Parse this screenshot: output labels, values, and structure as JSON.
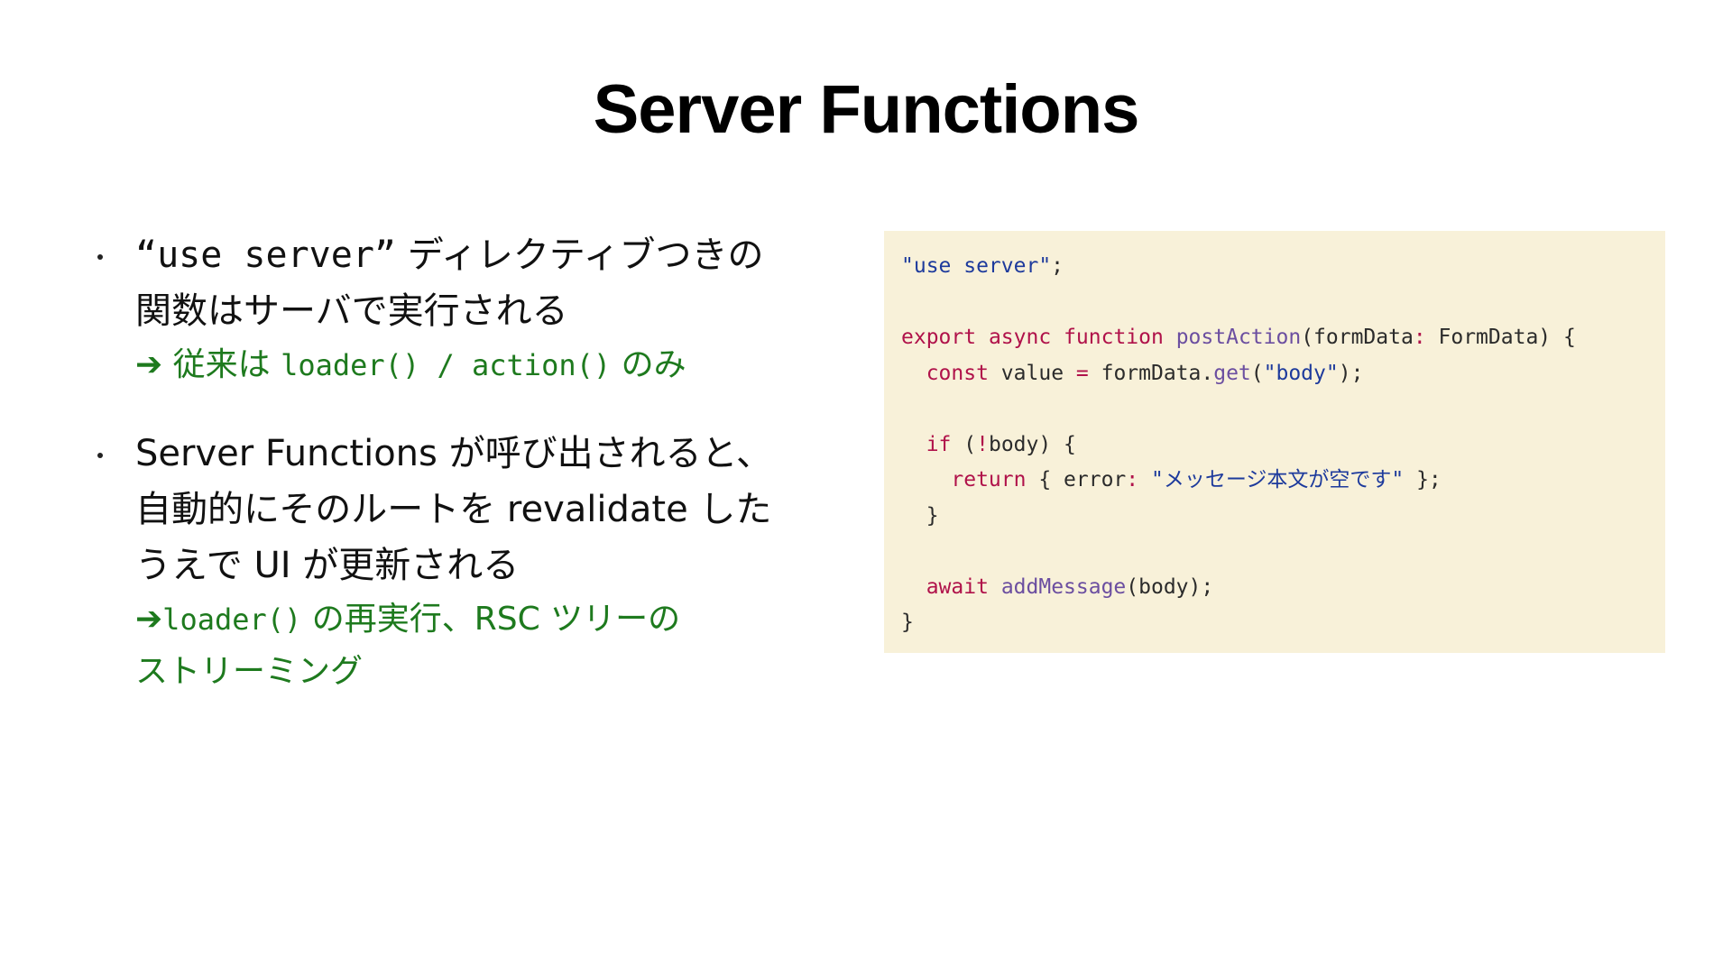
{
  "slide": {
    "title": "Server Functions"
  },
  "bullets": [
    {
      "line1_mono": "“use server”",
      "line1_rest": " ディレクティブつきの",
      "line2": "関数はサーバで実行される",
      "note_arrow": "➔",
      "note_prefix": "従来は ",
      "note_code1": "loader()",
      "note_mid": " / ",
      "note_code2": "action()",
      "note_suffix": " のみ"
    },
    {
      "line1": "Server Functions が呼び出されると、",
      "line2": "自動的にそのルートを revalidate した",
      "line3": "うえで UI が更新される",
      "note_arrow": "➔",
      "note_code": "loader()",
      "note_line1_rest": " の再実行、RSC ツリーの",
      "note_line2": "ストリーミング"
    }
  ],
  "code": {
    "l1_directive": "\"use server\"",
    "l1_semi": ";",
    "l3_export": "export",
    "l3_async": "async",
    "l3_function": "function",
    "l3_name": "postAction",
    "l3_params": "(formData",
    "l3_colon": ":",
    "l3_type": " FormData) {",
    "l4_const": "const",
    "l4_value": " value ",
    "l4_eq": "=",
    "l4_obj": " formData.",
    "l4_get": "get",
    "l4_open": "(",
    "l4_str": "\"body\"",
    "l4_close": ");",
    "l6_if": "if",
    "l6_open": " (",
    "l6_not": "!",
    "l6_rest": "body) {",
    "l7_return": "return",
    "l7_brace": " { error",
    "l7_colon": ":",
    "l7_str": " \"メッセージ本文が空です\"",
    "l7_end": " };",
    "l8_close": "}",
    "l10_await": "await",
    "l10_fn": "addMessage",
    "l10_rest": "(body);",
    "l11_close": "}"
  },
  "colors": {
    "keyword": "#b0124a",
    "function": "#6b4ea0",
    "string": "#1d3a9c",
    "note_green": "#1e7a1e",
    "code_bg": "#f8f1d9"
  }
}
